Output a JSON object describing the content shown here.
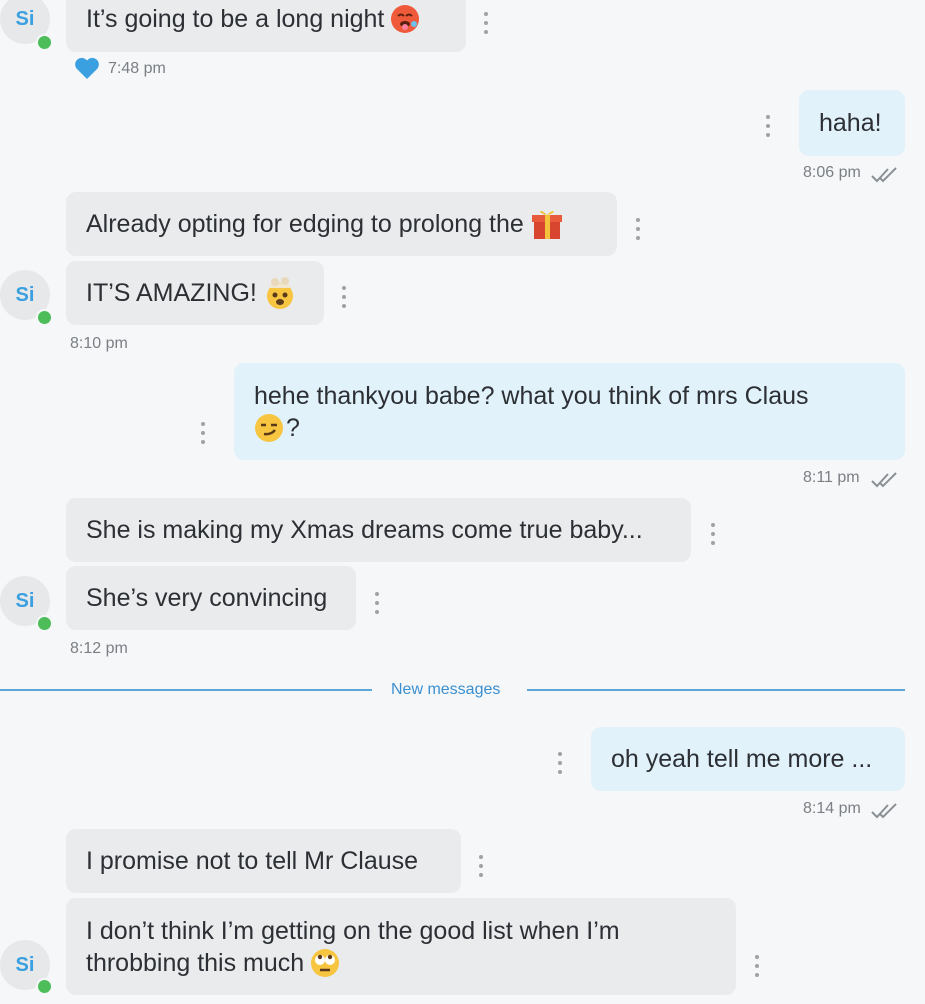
{
  "contact": {
    "initials": "Si",
    "status_color": "#4dbd5a"
  },
  "colors": {
    "incoming_bubble": "#e9ebed",
    "outgoing_bubble": "#e1f2fb",
    "accent": "#3a8fd0",
    "heart": "#3aa0e0"
  },
  "messages": [
    {
      "id": "m1",
      "direction": "in",
      "text": "It’s going to be a long night",
      "emoji": "hot-face"
    },
    {
      "id": "m2",
      "direction": "out",
      "text": "haha!"
    },
    {
      "id": "m3",
      "direction": "in",
      "text": "Already opting for edging to prolong the",
      "emoji": "gift"
    },
    {
      "id": "m4",
      "direction": "in",
      "text": "IT’S AMAZING!",
      "emoji": "exploding-head"
    },
    {
      "id": "m5",
      "direction": "out",
      "text_line1": "hehe thankyou babe? what you think of mrs Claus",
      "text_line2_suffix": "?",
      "emoji": "smirk"
    },
    {
      "id": "m6",
      "direction": "in",
      "text": "She is making my Xmas dreams come true baby..."
    },
    {
      "id": "m7",
      "direction": "in",
      "text": "She’s very convincing"
    },
    {
      "id": "m8",
      "direction": "out",
      "text": "oh yeah tell me more ..."
    },
    {
      "id": "m9",
      "direction": "in",
      "text": "I promise not to tell Mr Clause"
    },
    {
      "id": "m10",
      "direction": "in",
      "text_line1": "I don’t think I’m getting on the good list when I’m",
      "text_line2": "throbbing this much",
      "emoji": "eye-roll"
    }
  ],
  "timestamps": {
    "t1": "7:48 pm",
    "t2": "8:06 pm",
    "t3": "8:10 pm",
    "t4": "8:11 pm",
    "t5": "8:12 pm",
    "t6": "8:14 pm"
  },
  "reaction": {
    "icon": "heart-icon"
  },
  "divider": {
    "label": "New messages"
  }
}
